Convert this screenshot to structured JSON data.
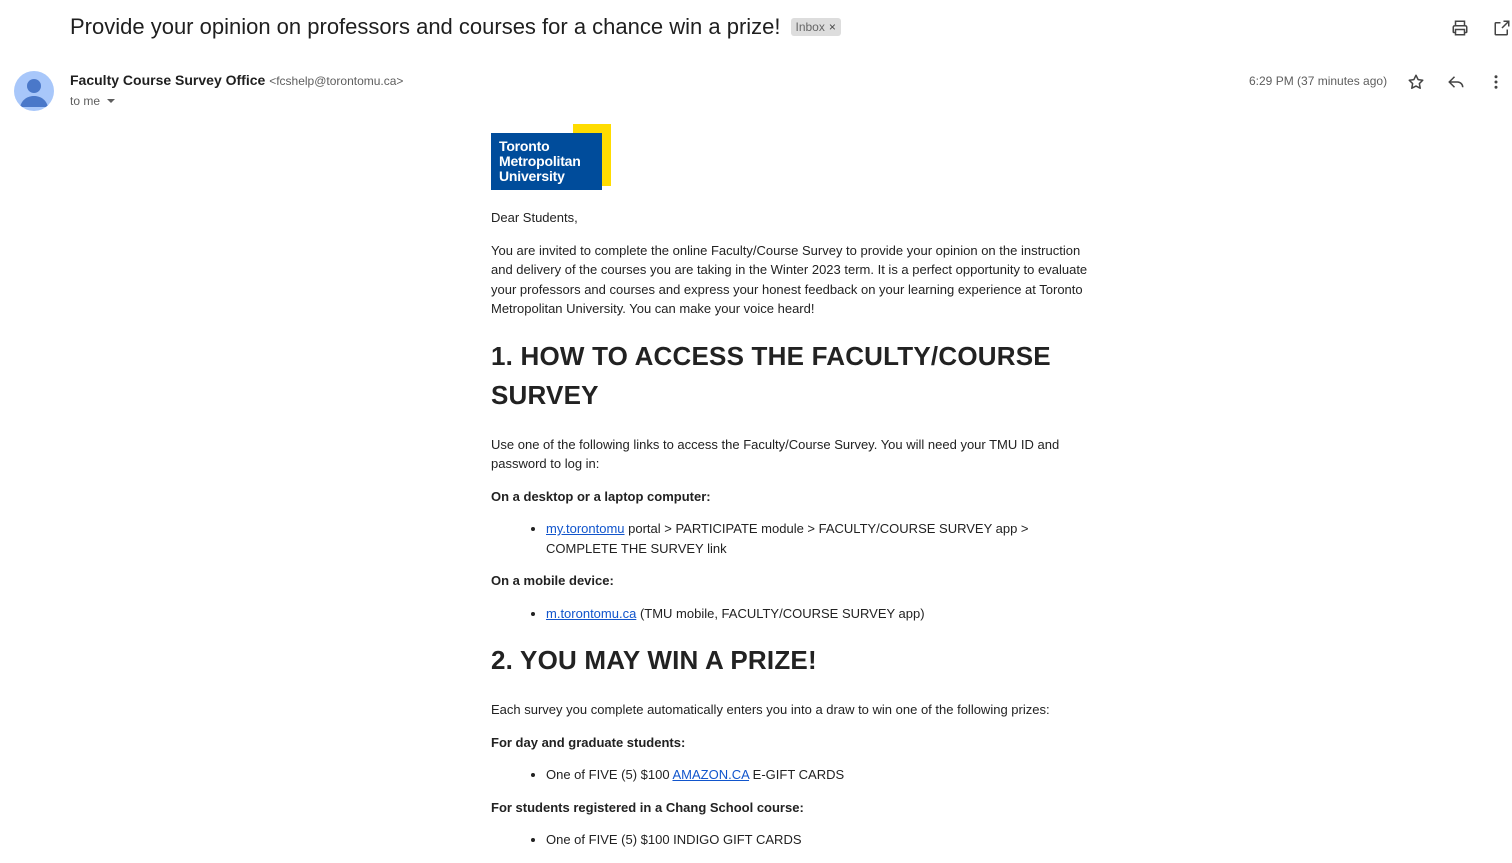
{
  "email": {
    "subject": "Provide your opinion on professors and courses for a chance win a prize!",
    "label": "Inbox",
    "label_remove": "×",
    "sender_name": "Faculty Course Survey Office",
    "sender_email": "<fcshelp@torontomu.ca>",
    "to": "to me",
    "time": "6:29 PM (37 minutes ago)"
  },
  "icons": {
    "print": "print-icon",
    "open": "open-in-new-window-icon",
    "star": "star-icon",
    "reply": "reply-icon",
    "more": "more-vert-icon",
    "avatar": "person-icon",
    "chevron": "chevron-down-icon"
  },
  "logo": {
    "line1": "Toronto",
    "line2": "Metropolitan",
    "line3": "University",
    "blue": "#004c9b",
    "yellow": "#ffdc00"
  },
  "body": {
    "greeting": "Dear Students,",
    "intro": "You are invited to complete the online Faculty/Course Survey to provide your opinion on the instruction and delivery of the courses you are taking in the Winter 2023 term. It is a perfect opportunity to evaluate your professors and courses and express your honest feedback on your learning experience at Toronto Metropolitan University. You can make your voice heard!",
    "h1": "1. HOW TO ACCESS THE FACULTY/COURSE SURVEY",
    "access_text": "Use one of the following links to access the Faculty/Course Survey. You will need your TMU ID and password to log in:",
    "desktop_heading": "On a desktop or a laptop computer:",
    "desktop_link": "my.torontomu",
    "desktop_rest": " portal > PARTICIPATE module > FACULTY/COURSE SURVEY app > COMPLETE THE SURVEY link",
    "mobile_heading": "On a mobile device:",
    "mobile_link": "m.torontomu.ca",
    "mobile_rest": " (TMU mobile, FACULTY/COURSE SURVEY app)",
    "h2": "2. YOU MAY WIN A PRIZE!",
    "prize_text": "Each survey you complete automatically enters you into a draw to win one of the following prizes:",
    "day_heading": "For day and graduate students:",
    "day_prize_pre": "One of FIVE (5)  $100 ",
    "day_prize_link": "AMAZON.CA",
    "day_prize_post": " E-GIFT CARDS",
    "chang_heading": "For students registered in a Chang School course:",
    "chang_prize": "One of FIVE (5)  $100 INDIGO GIFT CARDS"
  }
}
